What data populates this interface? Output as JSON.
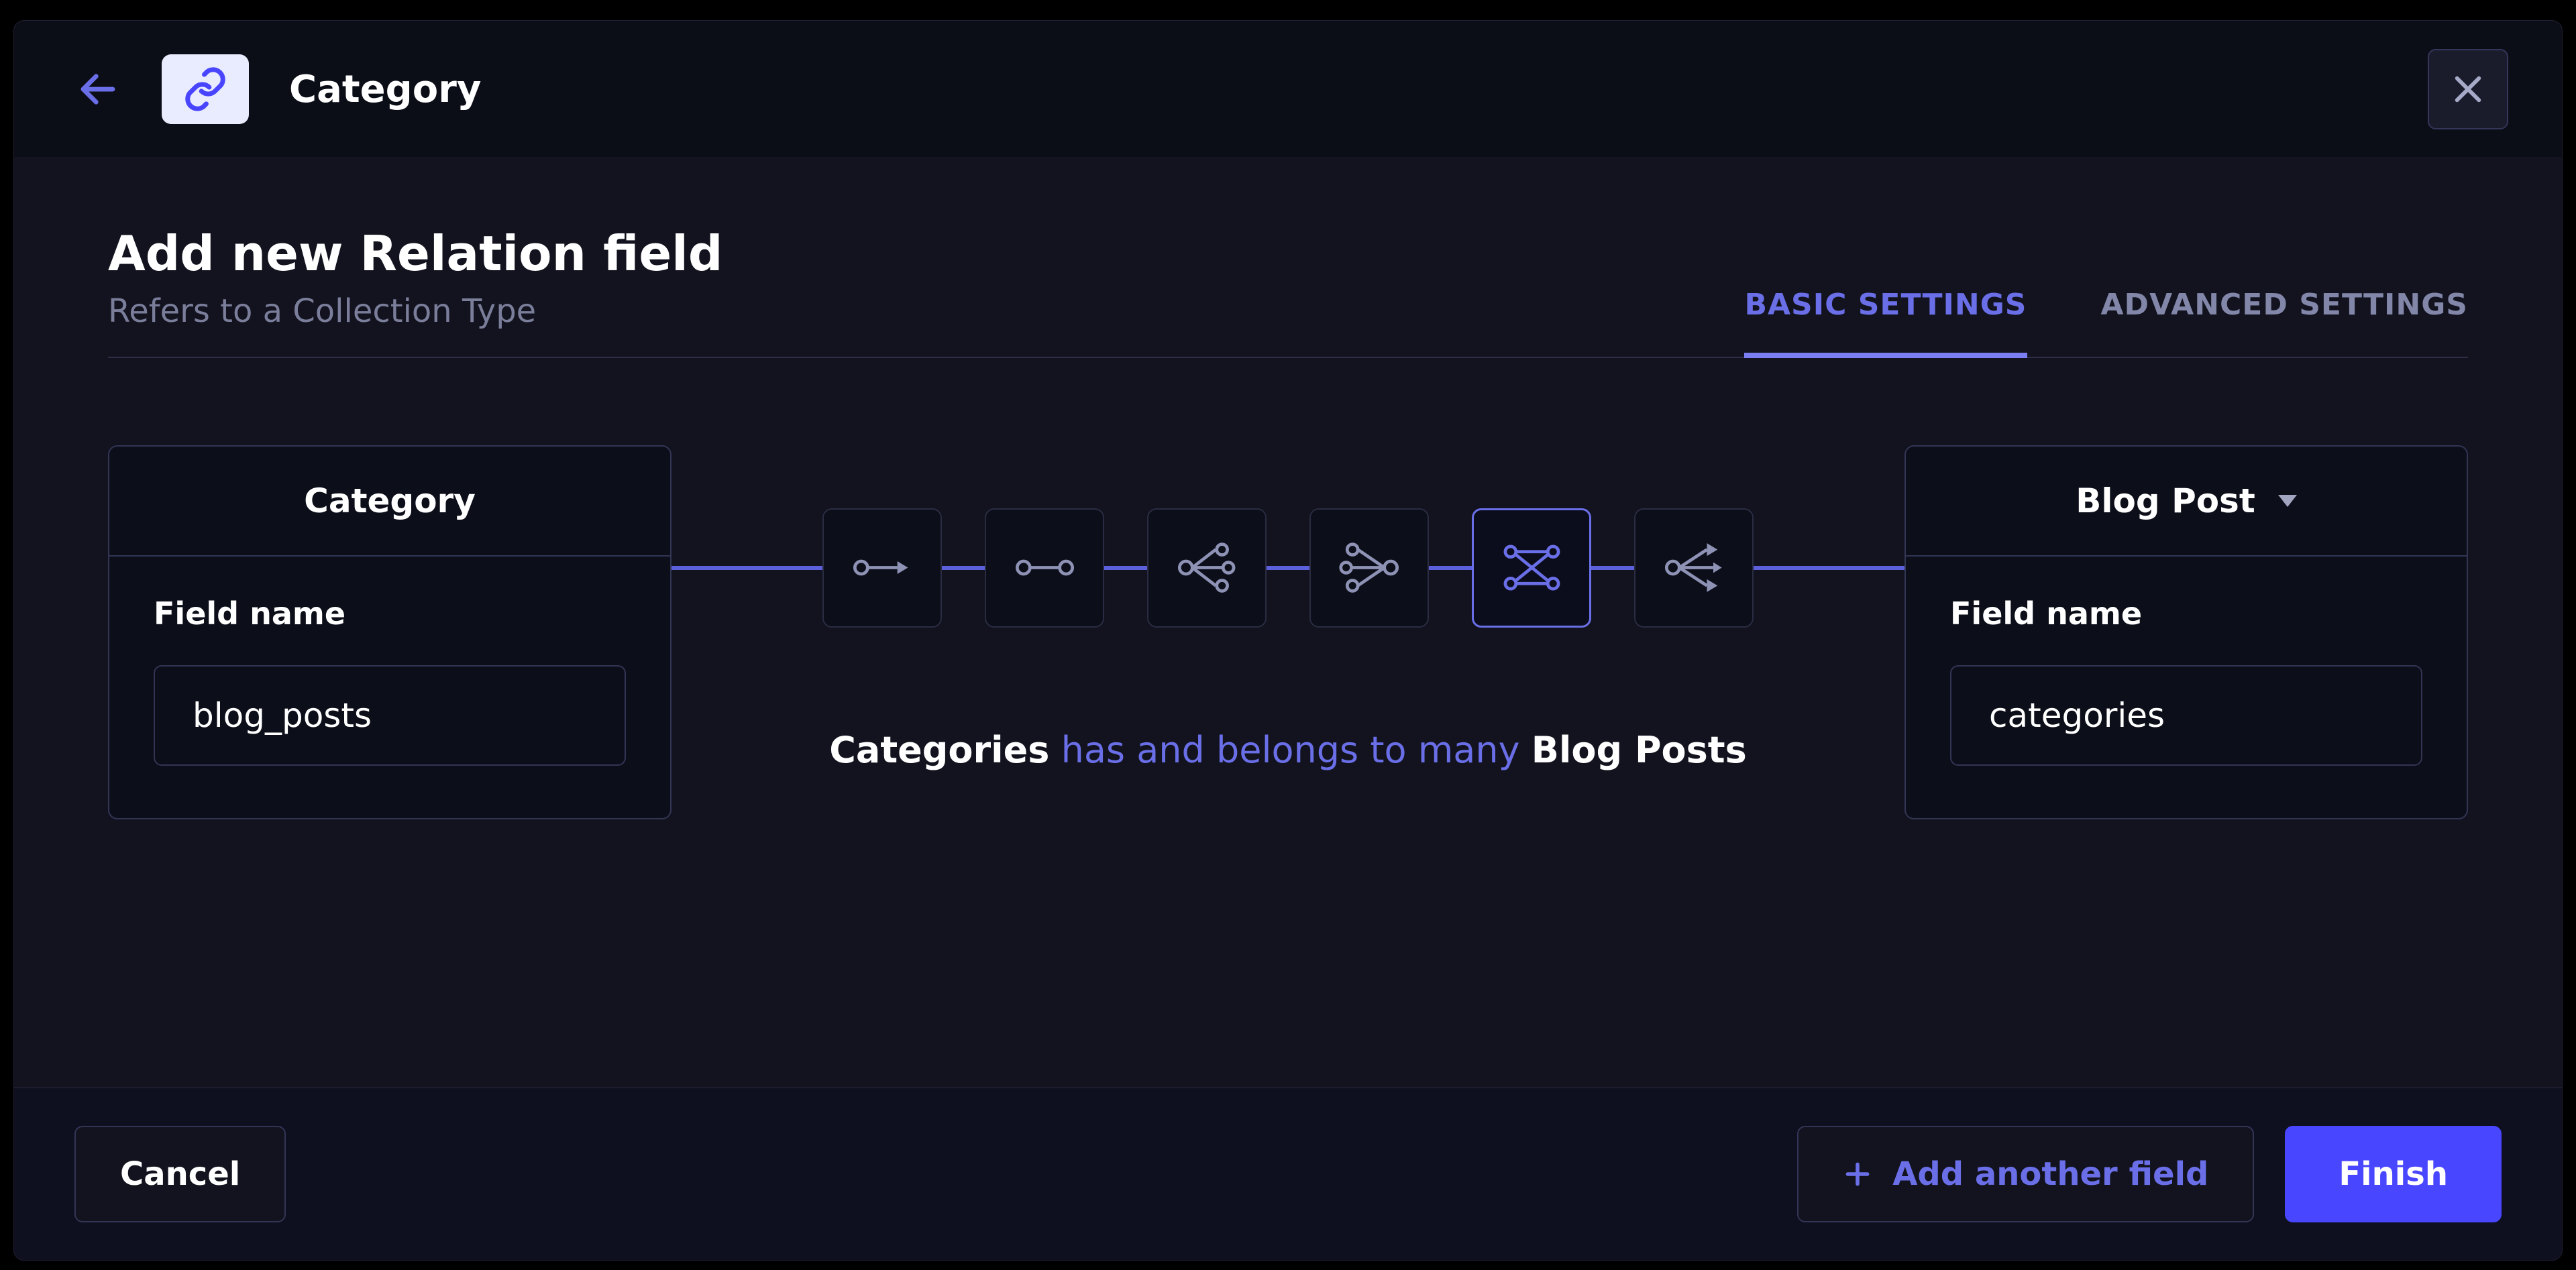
{
  "header": {
    "title": "Category"
  },
  "page": {
    "heading": "Add new Relation field",
    "subheading": "Refers to a Collection Type"
  },
  "tabs": {
    "basic": "BASIC SETTINGS",
    "advanced": "ADVANCED SETTINGS"
  },
  "left": {
    "title": "Category",
    "field_label": "Field name",
    "field_value": "blog_posts"
  },
  "right": {
    "title": "Blog Post",
    "field_label": "Field name",
    "field_value": "categories"
  },
  "relation": {
    "subject": "Categories",
    "phrase": " has and belongs to many ",
    "object": "Blog Posts"
  },
  "footer": {
    "cancel": "Cancel",
    "add_another": "Add another field",
    "finish": "Finish"
  }
}
